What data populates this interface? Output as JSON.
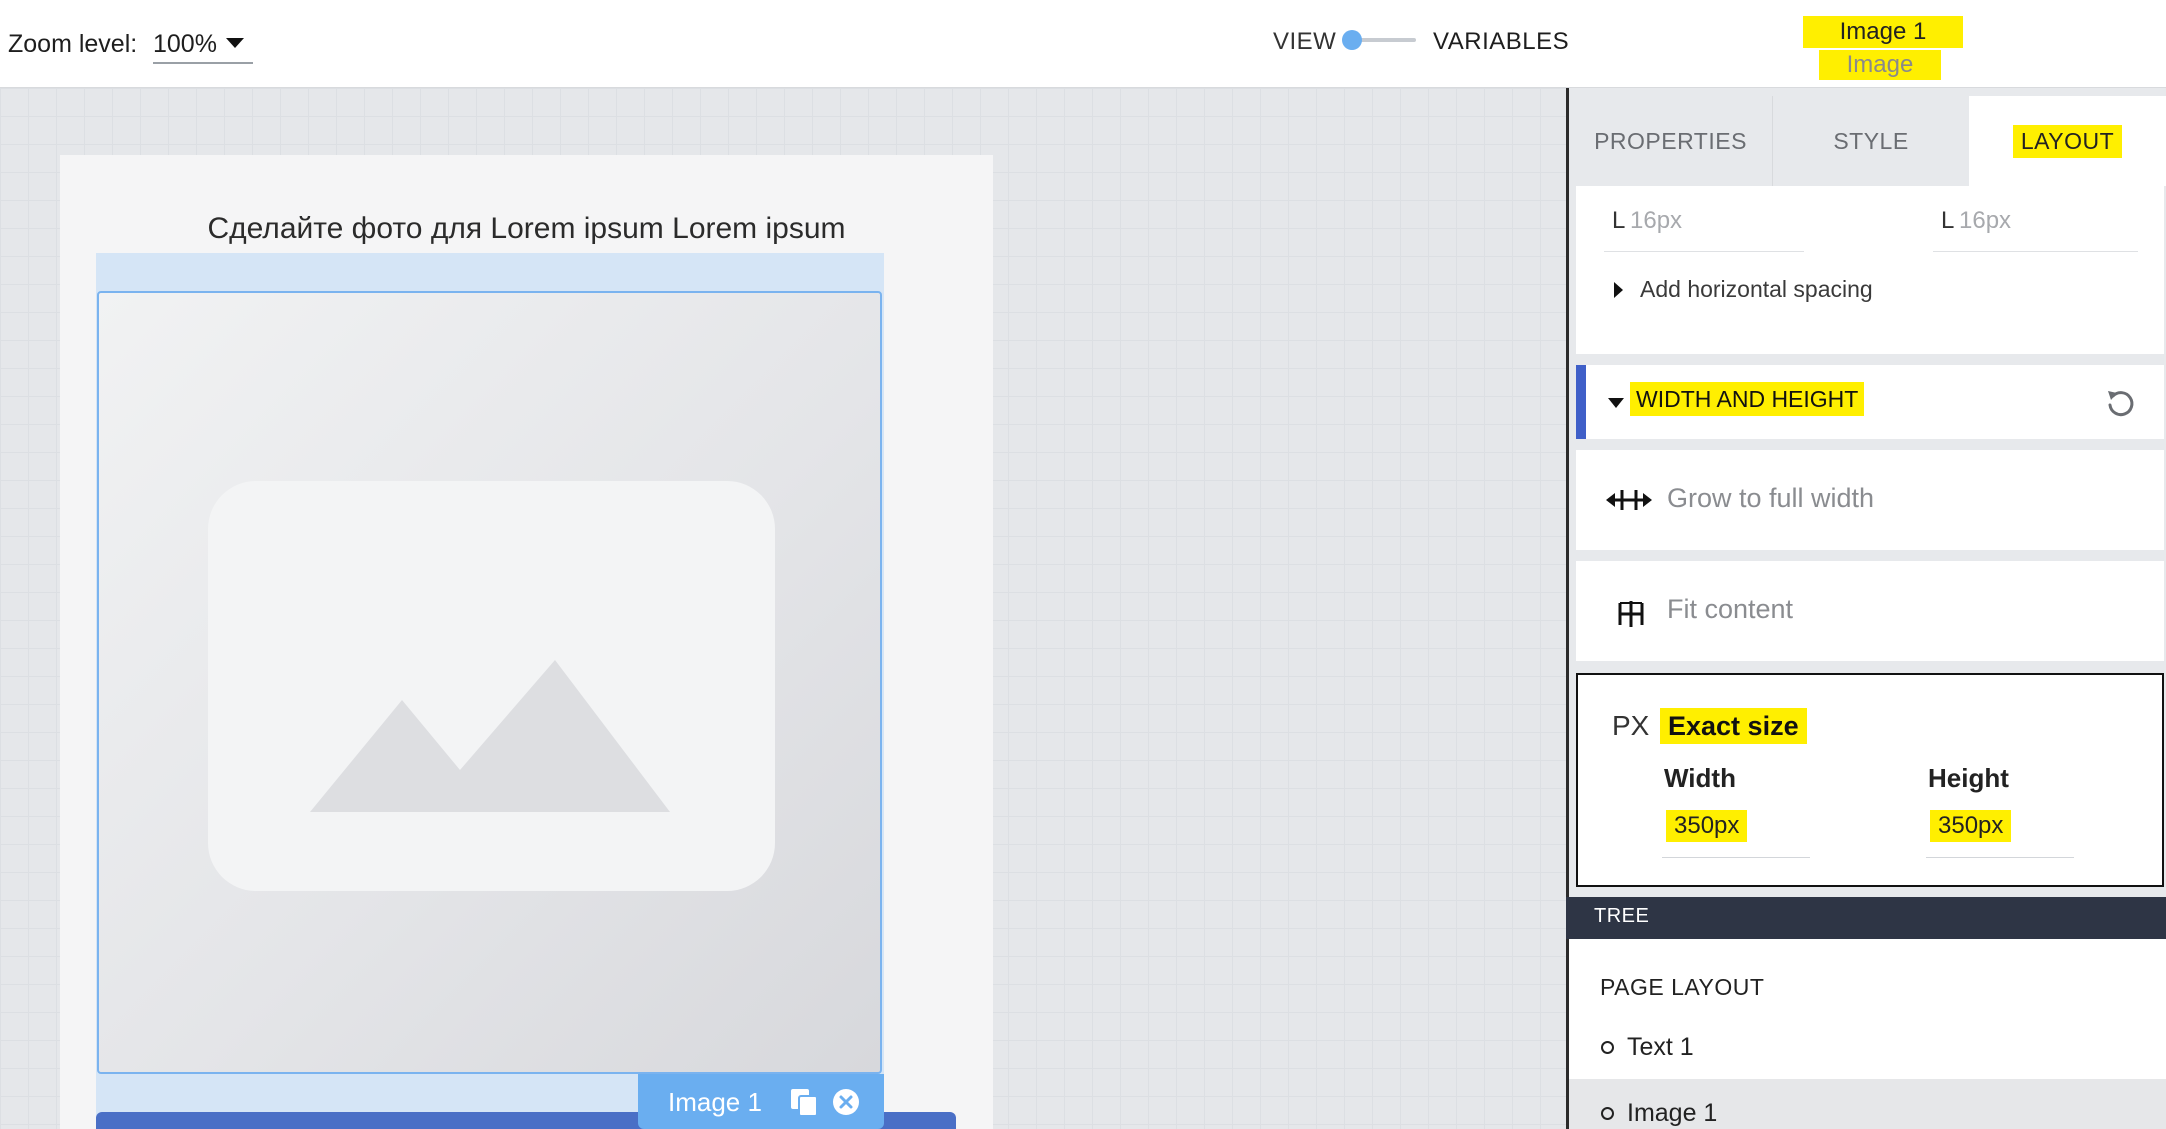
{
  "topbar": {
    "zoom_label": "Zoom level:",
    "zoom_value": "100%",
    "view_label": "VIEW",
    "variables_label": "VARIABLES",
    "selected_name": "Image 1",
    "selected_type": "Image"
  },
  "canvas": {
    "page_heading": "Сделайте фото для Lorem ipsum Lorem ipsum",
    "image_tag_label": "Image 1",
    "accent_color": "#6aaef0"
  },
  "panel": {
    "tabs": [
      {
        "label": "PROPERTIES"
      },
      {
        "label": "STYLE"
      },
      {
        "label": "LAYOUT",
        "active": true
      }
    ],
    "spacing": {
      "left_label": "L",
      "left_value": "16px",
      "right_label": "L",
      "right_value": "16px",
      "add_horizontal": "Add horizontal spacing"
    },
    "width_height": {
      "title": "WIDTH AND HEIGHT",
      "grow": "Grow to full width",
      "fit": "Fit content",
      "exact_prefix": "PX",
      "exact_title": "Exact size",
      "width_label": "Width",
      "width_value": "350px",
      "height_label": "Height",
      "height_value": "350px"
    }
  },
  "tree": {
    "header": "TREE",
    "section": "PAGE LAYOUT",
    "items": [
      {
        "label": "Text 1"
      },
      {
        "label": "Image 1",
        "selected": true
      }
    ]
  },
  "colors": {
    "highlight": "#ffef00",
    "tree_header": "#2e3545",
    "section_bar": "#3f5fc8"
  }
}
